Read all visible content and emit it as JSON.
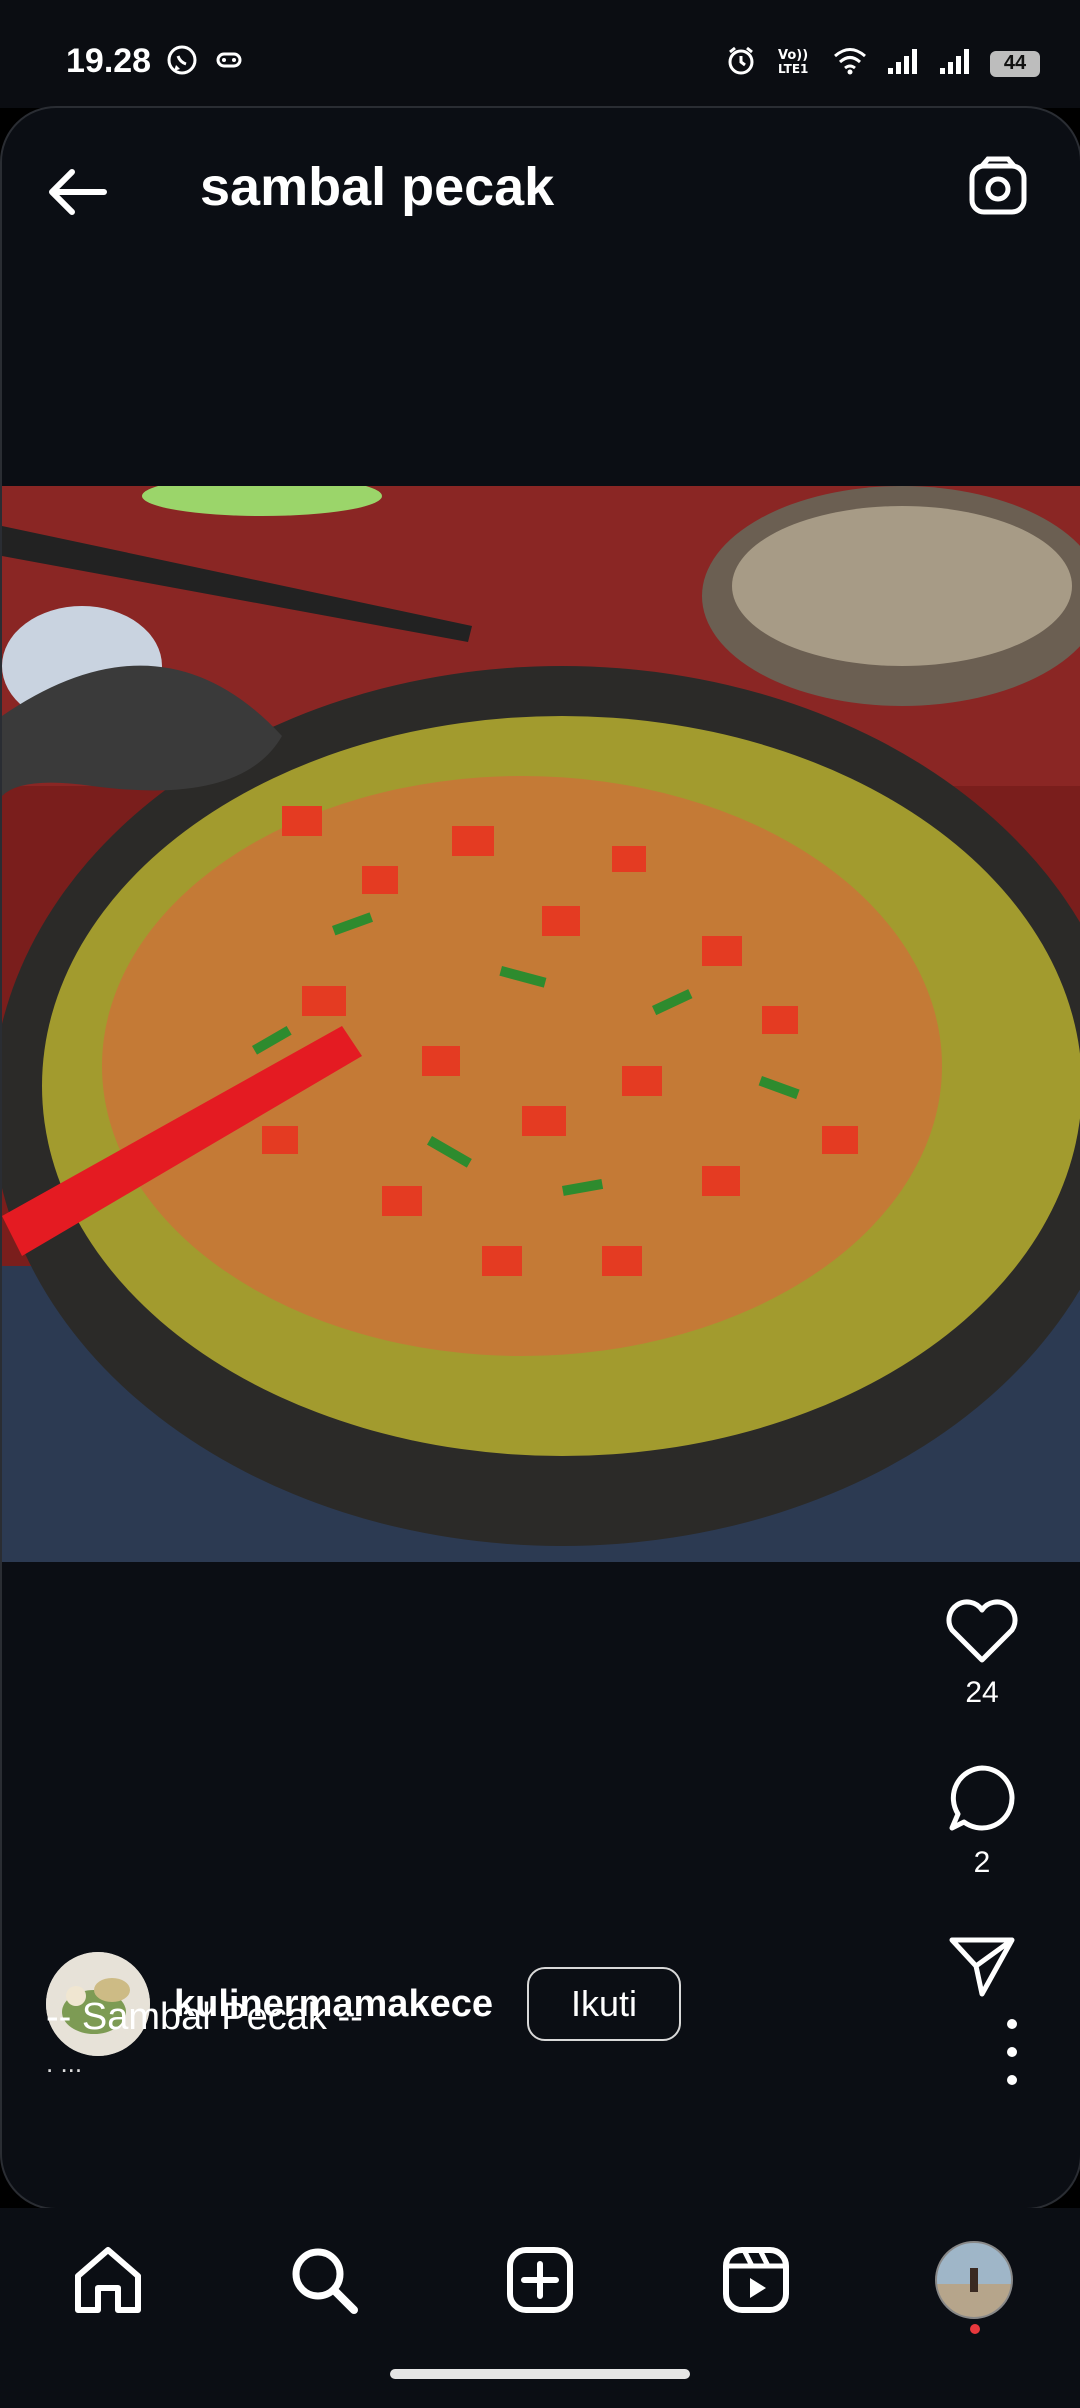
{
  "status_bar": {
    "time": "19.28",
    "battery": "44",
    "icons": [
      "whatsapp-icon",
      "game-icon",
      "alarm-icon",
      "volte-icon",
      "wifi-icon",
      "signal-icon",
      "signal-icon-2",
      "battery-icon"
    ]
  },
  "header": {
    "title": "sambal pecak",
    "back_icon": "back-arrow-icon",
    "camera_icon": "camera-icon"
  },
  "post": {
    "likes": "24",
    "comments": "2",
    "username": "kulinermamakece",
    "follow_label": "Ikuti",
    "caption_line1": "-- Sambal Pecak --",
    "caption_line2": ". ...",
    "icons": [
      "heart-icon",
      "comment-icon",
      "share-icon",
      "more-icon"
    ]
  },
  "bottom_nav": {
    "items": [
      "home-icon",
      "search-icon",
      "create-icon",
      "reels-icon",
      "profile-avatar"
    ]
  },
  "colors": {
    "background": "#0b0e14",
    "text": "#ffffff",
    "accent_red": "#e8383d"
  }
}
